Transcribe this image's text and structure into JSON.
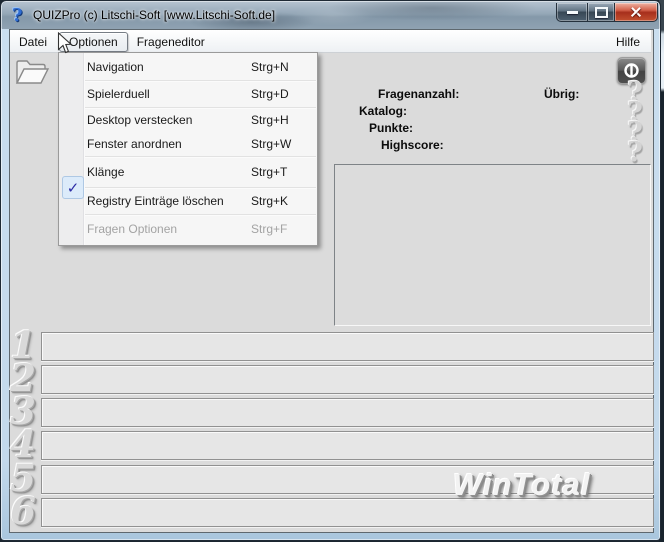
{
  "window": {
    "title": "QUIZPro (c) Litschi-Soft [www.Litschi-Soft.de]"
  },
  "menubar": {
    "items": [
      {
        "label": "Datei"
      },
      {
        "label": "Optionen"
      },
      {
        "label": "Frageneditor"
      },
      {
        "label": "Hilfe"
      }
    ]
  },
  "options_menu": {
    "items": [
      {
        "label": "Navigation",
        "shortcut": "Strg+N",
        "checked": false,
        "enabled": true
      },
      {
        "label": "Spielerduell",
        "shortcut": "Strg+D",
        "checked": false,
        "enabled": true
      },
      {
        "label": "Desktop verstecken",
        "shortcut": "Strg+H",
        "checked": false,
        "enabled": true
      },
      {
        "label": "Fenster anordnen",
        "shortcut": "Strg+W",
        "checked": false,
        "enabled": true
      },
      {
        "label": "Klänge",
        "shortcut": "Strg+T",
        "checked": true,
        "enabled": true
      },
      {
        "label": "Registry Einträge löschen",
        "shortcut": "Strg+K",
        "checked": false,
        "enabled": true
      },
      {
        "label": "Fragen Optionen",
        "shortcut": "Strg+F",
        "checked": false,
        "enabled": false
      }
    ]
  },
  "status_labels": {
    "fragenanzahl": "Fragenanzahl:",
    "katalog": "Katalog:",
    "punkte": "Punkte:",
    "highscore": "Highscore:",
    "uebrig": "Übrig:"
  },
  "answer_slots": {
    "numbers": [
      "1",
      "2",
      "3",
      "4",
      "5",
      "6"
    ]
  },
  "watermark": {
    "text": "WinTotal"
  },
  "glyphs": {
    "app_icon": "?",
    "decor_question": "?",
    "check": "✓"
  },
  "colors": {
    "titlebar": "#8ba0b2",
    "frame_glass": "#c3d9ec",
    "client_bg": "#dbdbdb",
    "close_button": "#a72f1c",
    "menu_check": "#2d2da6"
  }
}
